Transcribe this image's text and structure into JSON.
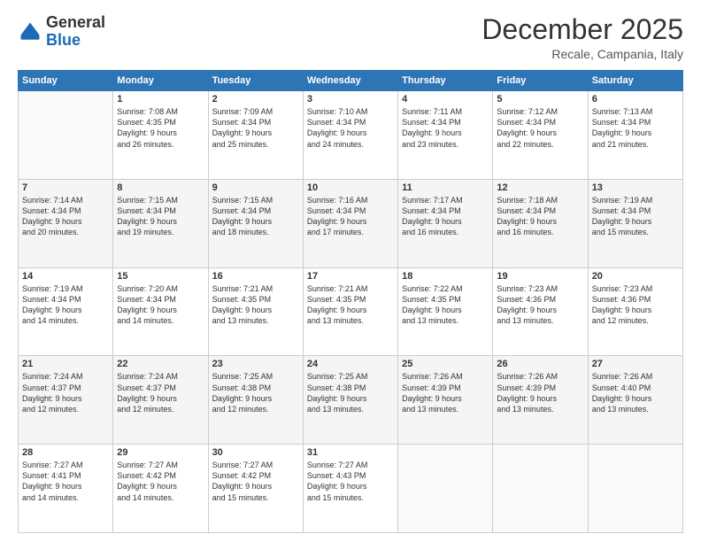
{
  "header": {
    "logo_general": "General",
    "logo_blue": "Blue",
    "month_title": "December 2025",
    "subtitle": "Recale, Campania, Italy"
  },
  "days_of_week": [
    "Sunday",
    "Monday",
    "Tuesday",
    "Wednesday",
    "Thursday",
    "Friday",
    "Saturday"
  ],
  "weeks": [
    [
      {
        "day": "",
        "info": ""
      },
      {
        "day": "1",
        "info": "Sunrise: 7:08 AM\nSunset: 4:35 PM\nDaylight: 9 hours\nand 26 minutes."
      },
      {
        "day": "2",
        "info": "Sunrise: 7:09 AM\nSunset: 4:34 PM\nDaylight: 9 hours\nand 25 minutes."
      },
      {
        "day": "3",
        "info": "Sunrise: 7:10 AM\nSunset: 4:34 PM\nDaylight: 9 hours\nand 24 minutes."
      },
      {
        "day": "4",
        "info": "Sunrise: 7:11 AM\nSunset: 4:34 PM\nDaylight: 9 hours\nand 23 minutes."
      },
      {
        "day": "5",
        "info": "Sunrise: 7:12 AM\nSunset: 4:34 PM\nDaylight: 9 hours\nand 22 minutes."
      },
      {
        "day": "6",
        "info": "Sunrise: 7:13 AM\nSunset: 4:34 PM\nDaylight: 9 hours\nand 21 minutes."
      }
    ],
    [
      {
        "day": "7",
        "info": "Sunrise: 7:14 AM\nSunset: 4:34 PM\nDaylight: 9 hours\nand 20 minutes."
      },
      {
        "day": "8",
        "info": "Sunrise: 7:15 AM\nSunset: 4:34 PM\nDaylight: 9 hours\nand 19 minutes."
      },
      {
        "day": "9",
        "info": "Sunrise: 7:15 AM\nSunset: 4:34 PM\nDaylight: 9 hours\nand 18 minutes."
      },
      {
        "day": "10",
        "info": "Sunrise: 7:16 AM\nSunset: 4:34 PM\nDaylight: 9 hours\nand 17 minutes."
      },
      {
        "day": "11",
        "info": "Sunrise: 7:17 AM\nSunset: 4:34 PM\nDaylight: 9 hours\nand 16 minutes."
      },
      {
        "day": "12",
        "info": "Sunrise: 7:18 AM\nSunset: 4:34 PM\nDaylight: 9 hours\nand 16 minutes."
      },
      {
        "day": "13",
        "info": "Sunrise: 7:19 AM\nSunset: 4:34 PM\nDaylight: 9 hours\nand 15 minutes."
      }
    ],
    [
      {
        "day": "14",
        "info": "Sunrise: 7:19 AM\nSunset: 4:34 PM\nDaylight: 9 hours\nand 14 minutes."
      },
      {
        "day": "15",
        "info": "Sunrise: 7:20 AM\nSunset: 4:34 PM\nDaylight: 9 hours\nand 14 minutes."
      },
      {
        "day": "16",
        "info": "Sunrise: 7:21 AM\nSunset: 4:35 PM\nDaylight: 9 hours\nand 13 minutes."
      },
      {
        "day": "17",
        "info": "Sunrise: 7:21 AM\nSunset: 4:35 PM\nDaylight: 9 hours\nand 13 minutes."
      },
      {
        "day": "18",
        "info": "Sunrise: 7:22 AM\nSunset: 4:35 PM\nDaylight: 9 hours\nand 13 minutes."
      },
      {
        "day": "19",
        "info": "Sunrise: 7:23 AM\nSunset: 4:36 PM\nDaylight: 9 hours\nand 13 minutes."
      },
      {
        "day": "20",
        "info": "Sunrise: 7:23 AM\nSunset: 4:36 PM\nDaylight: 9 hours\nand 12 minutes."
      }
    ],
    [
      {
        "day": "21",
        "info": "Sunrise: 7:24 AM\nSunset: 4:37 PM\nDaylight: 9 hours\nand 12 minutes."
      },
      {
        "day": "22",
        "info": "Sunrise: 7:24 AM\nSunset: 4:37 PM\nDaylight: 9 hours\nand 12 minutes."
      },
      {
        "day": "23",
        "info": "Sunrise: 7:25 AM\nSunset: 4:38 PM\nDaylight: 9 hours\nand 12 minutes."
      },
      {
        "day": "24",
        "info": "Sunrise: 7:25 AM\nSunset: 4:38 PM\nDaylight: 9 hours\nand 13 minutes."
      },
      {
        "day": "25",
        "info": "Sunrise: 7:26 AM\nSunset: 4:39 PM\nDaylight: 9 hours\nand 13 minutes."
      },
      {
        "day": "26",
        "info": "Sunrise: 7:26 AM\nSunset: 4:39 PM\nDaylight: 9 hours\nand 13 minutes."
      },
      {
        "day": "27",
        "info": "Sunrise: 7:26 AM\nSunset: 4:40 PM\nDaylight: 9 hours\nand 13 minutes."
      }
    ],
    [
      {
        "day": "28",
        "info": "Sunrise: 7:27 AM\nSunset: 4:41 PM\nDaylight: 9 hours\nand 14 minutes."
      },
      {
        "day": "29",
        "info": "Sunrise: 7:27 AM\nSunset: 4:42 PM\nDaylight: 9 hours\nand 14 minutes."
      },
      {
        "day": "30",
        "info": "Sunrise: 7:27 AM\nSunset: 4:42 PM\nDaylight: 9 hours\nand 15 minutes."
      },
      {
        "day": "31",
        "info": "Sunrise: 7:27 AM\nSunset: 4:43 PM\nDaylight: 9 hours\nand 15 minutes."
      },
      {
        "day": "",
        "info": ""
      },
      {
        "day": "",
        "info": ""
      },
      {
        "day": "",
        "info": ""
      }
    ]
  ]
}
